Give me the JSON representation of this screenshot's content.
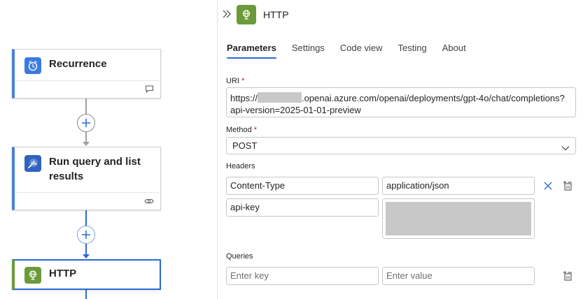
{
  "canvas": {
    "cards": [
      {
        "title": "Recurrence",
        "icon": "clock-icon",
        "foot_icon": "comment-icon",
        "accent": "#4a7fd4",
        "icon_bg": "#3b7ae0"
      },
      {
        "title": "Run query and list results",
        "icon": "log-analytics-icon",
        "foot_icon": "link-icon",
        "accent": "#4a7fd4",
        "icon_bg": "#2f63c1"
      },
      {
        "title": "HTTP",
        "icon": "globe-icon",
        "accent": "#6b9a3a",
        "icon_bg": "#6b9a3a"
      }
    ],
    "add_step_icon": "plus-icon",
    "connector_colors": {
      "inactive": "#a0a0a0",
      "active": "#2a6bd1"
    }
  },
  "panel": {
    "title": "HTTP",
    "collapse_icon": "double-chevron-right-icon",
    "tabs": [
      {
        "label": "Parameters",
        "active": true
      },
      {
        "label": "Settings",
        "active": false
      },
      {
        "label": "Code view",
        "active": false
      },
      {
        "label": "Testing",
        "active": false
      },
      {
        "label": "About",
        "active": false
      }
    ],
    "uri": {
      "label": "URI",
      "required_mark": "*",
      "prefix": "https://",
      "line1_rest": ".openai.azure.com/openai/deployments/gpt-4o/chat/completions?",
      "line2": "api-version=2025-01-01-preview"
    },
    "method": {
      "label": "Method",
      "required_mark": "*",
      "value": "POST"
    },
    "headers": {
      "label": "Headers",
      "rows": [
        {
          "key": "Content-Type",
          "value": "application/json"
        },
        {
          "key": "api-key",
          "value": ""
        }
      ]
    },
    "queries": {
      "label": "Queries",
      "key_placeholder": "Enter key",
      "value_placeholder": "Enter value"
    }
  },
  "colors": {
    "accent_blue": "#2a6bd1",
    "http_green": "#6b9a3a",
    "required_red": "#c50f1f",
    "mask_gray": "#c8c8c8"
  }
}
